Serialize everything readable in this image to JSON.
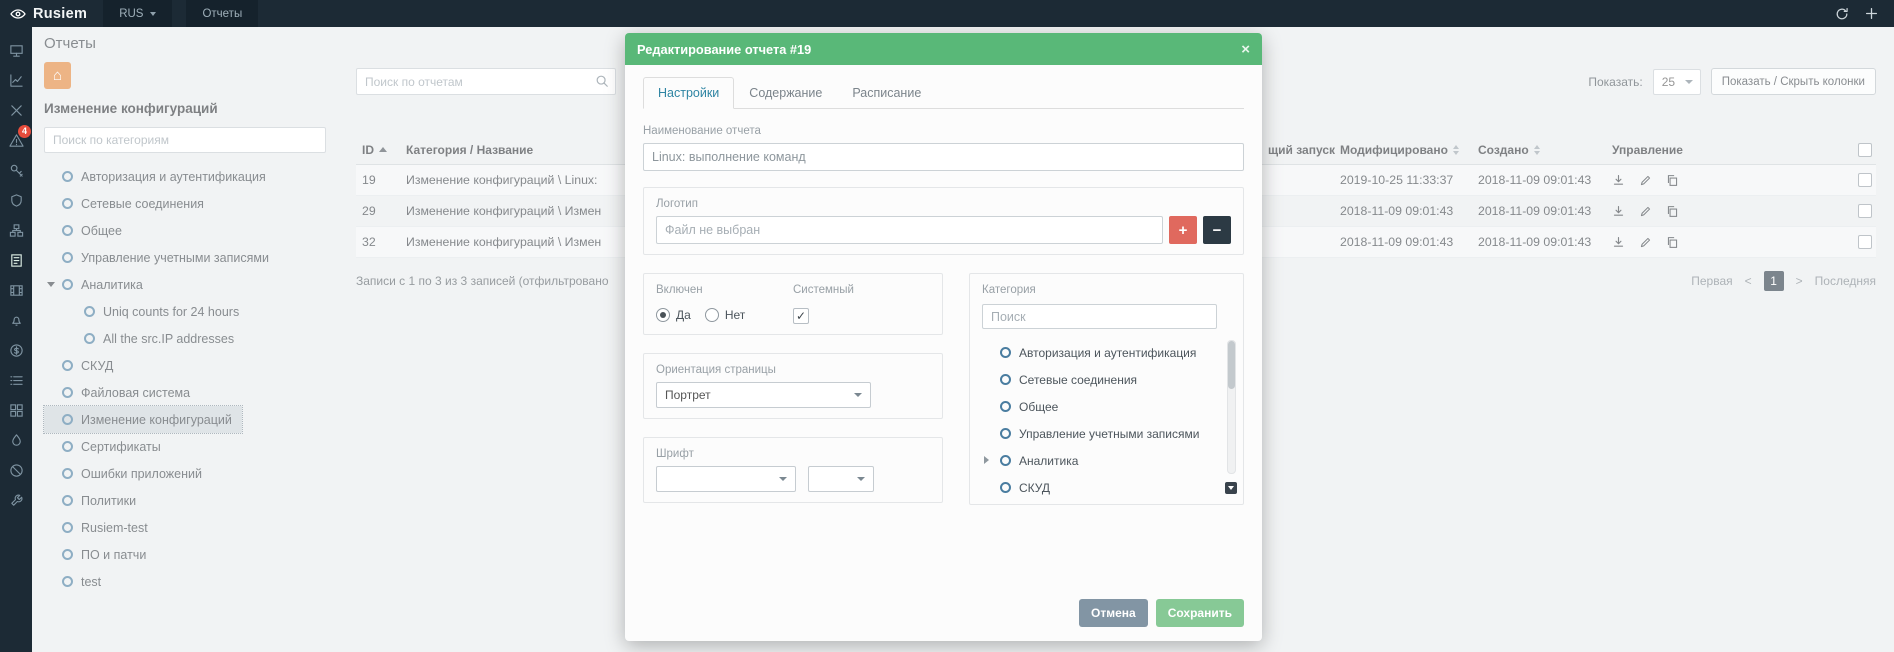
{
  "navbar": {
    "brand": "Rusiem",
    "lang": "RUS",
    "menu": "Отчеты"
  },
  "sidebar": {
    "alert_badge": "4",
    "icons": [
      "dashboard",
      "analytics",
      "tools",
      "alerts",
      "key",
      "shield",
      "topology",
      "reports",
      "media",
      "notifications",
      "billing",
      "tasks",
      "modules",
      "fire",
      "ban",
      "wrench"
    ],
    "active_icon": "reports"
  },
  "page": {
    "title": "Отчеты",
    "subtitle": "Изменение конфигураций",
    "category_search_placeholder": "Поиск по категориям"
  },
  "tree": {
    "items": [
      {
        "label": "Авторизация и аутентификация",
        "depth": 0
      },
      {
        "label": "Сетевые соединения",
        "depth": 0
      },
      {
        "label": "Общее",
        "depth": 0
      },
      {
        "label": "Управление учетными записями",
        "depth": 0
      },
      {
        "label": "Аналитика",
        "depth": 0,
        "expanded": true
      },
      {
        "label": "Uniq counts for 24 hours",
        "depth": 1
      },
      {
        "label": "All the src.IP addresses",
        "depth": 1
      },
      {
        "label": "СКУД",
        "depth": 0
      },
      {
        "label": "Файловая система",
        "depth": 0
      },
      {
        "label": "Изменение конфигураций",
        "depth": 0,
        "selected": true
      },
      {
        "label": "Сертификаты",
        "depth": 0
      },
      {
        "label": "Ошибки приложений",
        "depth": 0
      },
      {
        "label": "Политики",
        "depth": 0
      },
      {
        "label": "Rusiem-test",
        "depth": 0
      },
      {
        "label": "ПО и патчи",
        "depth": 0
      },
      {
        "label": "test",
        "depth": 0
      }
    ]
  },
  "toolbar": {
    "search_placeholder": "Поиск по отчетам",
    "show_label": "Показать:",
    "page_size": "25",
    "toggle_columns_label": "Показать / Скрыть колонки"
  },
  "table": {
    "headers": {
      "id": "ID",
      "name": "Категория / Название",
      "next_run": "щий запуск",
      "modified": "Модифицировано",
      "created": "Создано",
      "actions": "Управление"
    },
    "rows": [
      {
        "id": "19",
        "name": "Изменение конфигураций \\ Linux:",
        "modified": "2019-10-25 11:33:37",
        "created": "2018-11-09 09:01:43"
      },
      {
        "id": "29",
        "name": "Изменение конфигураций \\ Измен",
        "modified": "2018-11-09 09:01:43",
        "created": "2018-11-09 09:01:43"
      },
      {
        "id": "32",
        "name": "Изменение конфигураций \\ Измен",
        "modified": "2018-11-09 09:01:43",
        "created": "2018-11-09 09:01:43"
      }
    ],
    "summary": "Записи с 1 по 3 из 3 записей (отфильтровано",
    "pagination": {
      "first": "Первая",
      "prev": "<",
      "current": "1",
      "next": ">",
      "last": "Последняя"
    }
  },
  "modal": {
    "title": "Редактирование отчета #19",
    "close_label": "×",
    "tabs": [
      {
        "label": "Настройки",
        "active": true
      },
      {
        "label": "Содержание"
      },
      {
        "label": "Расписание"
      }
    ],
    "name_label": "Наименование отчета",
    "name_value": "Linux: выполнение команд",
    "logo_label": "Логотип",
    "logo_placeholder": "Файл не выбран",
    "add_label": "+",
    "remove_label": "−",
    "enabled_label": "Включен",
    "enabled_yes": "Да",
    "enabled_no": "Нет",
    "enabled_value": "Да",
    "system_label": "Системный",
    "system_checked": true,
    "check_glyph": "✓",
    "orientation_label": "Ориентация страницы",
    "orientation_value": "Портрет",
    "font_label": "Шрифт",
    "category_label": "Категория",
    "category_search_placeholder": "Поиск",
    "category_items": [
      {
        "label": "Авторизация и аутентификация"
      },
      {
        "label": "Сетевые соединения"
      },
      {
        "label": "Общее"
      },
      {
        "label": "Управление учетными записями"
      },
      {
        "label": "Аналитика",
        "expandable": true
      },
      {
        "label": "СКУД"
      }
    ],
    "cancel_label": "Отмена",
    "save_label": "Сохранить"
  }
}
